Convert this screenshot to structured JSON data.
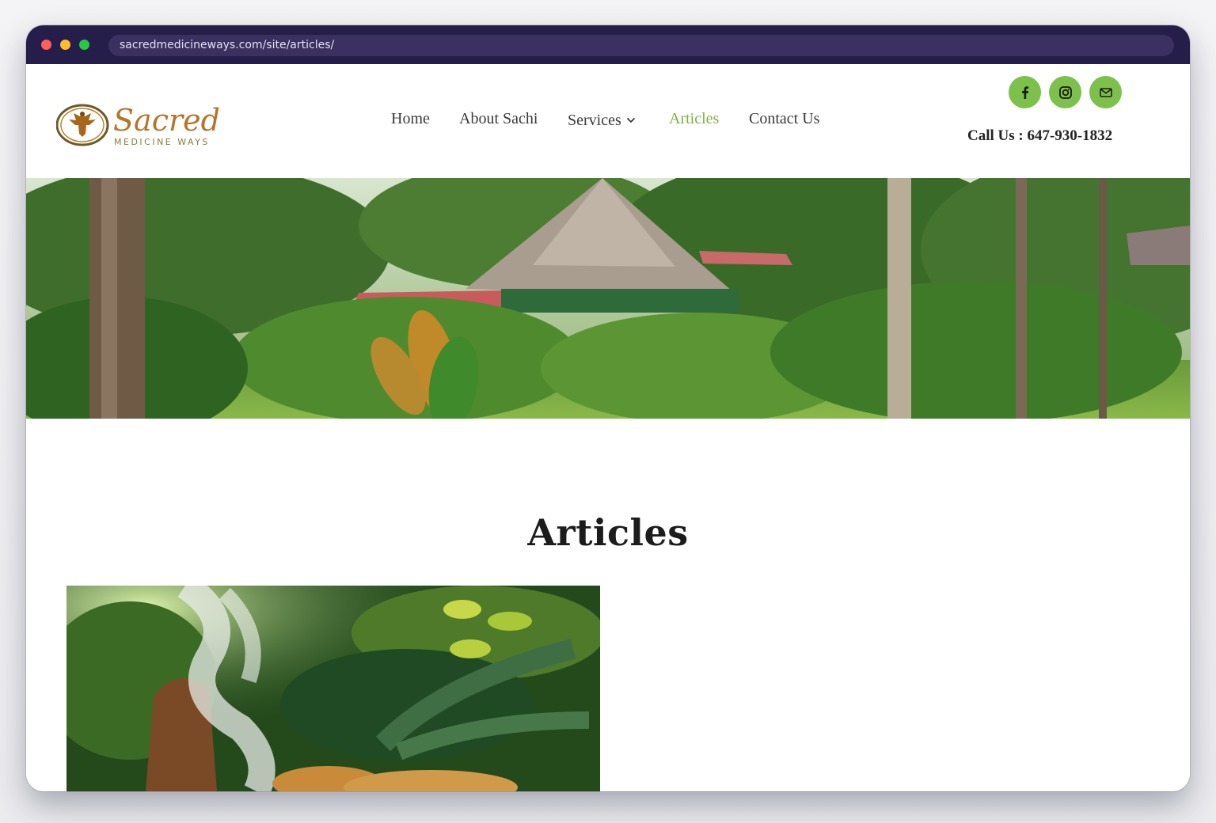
{
  "browser": {
    "url": "sacredmedicineways.com/site/articles/"
  },
  "logo": {
    "script_text": "Sacred",
    "subtitle": "MEDICINE WAYS"
  },
  "nav": {
    "items": [
      {
        "label": "Home",
        "active": false
      },
      {
        "label": "About Sachi",
        "active": false
      },
      {
        "label": "Services",
        "active": false,
        "has_dropdown": true
      },
      {
        "label": "Articles",
        "active": true
      },
      {
        "label": "Contact Us",
        "active": false
      }
    ]
  },
  "social": {
    "icons": [
      "facebook-icon",
      "instagram-icon",
      "mail-icon"
    ]
  },
  "contact": {
    "call_text": "Call Us : 647-930-1832"
  },
  "page": {
    "title": "Articles"
  },
  "colors": {
    "accent_green": "#7dc04b",
    "active_nav": "#7db240",
    "chrome_bg": "#251d4a"
  }
}
